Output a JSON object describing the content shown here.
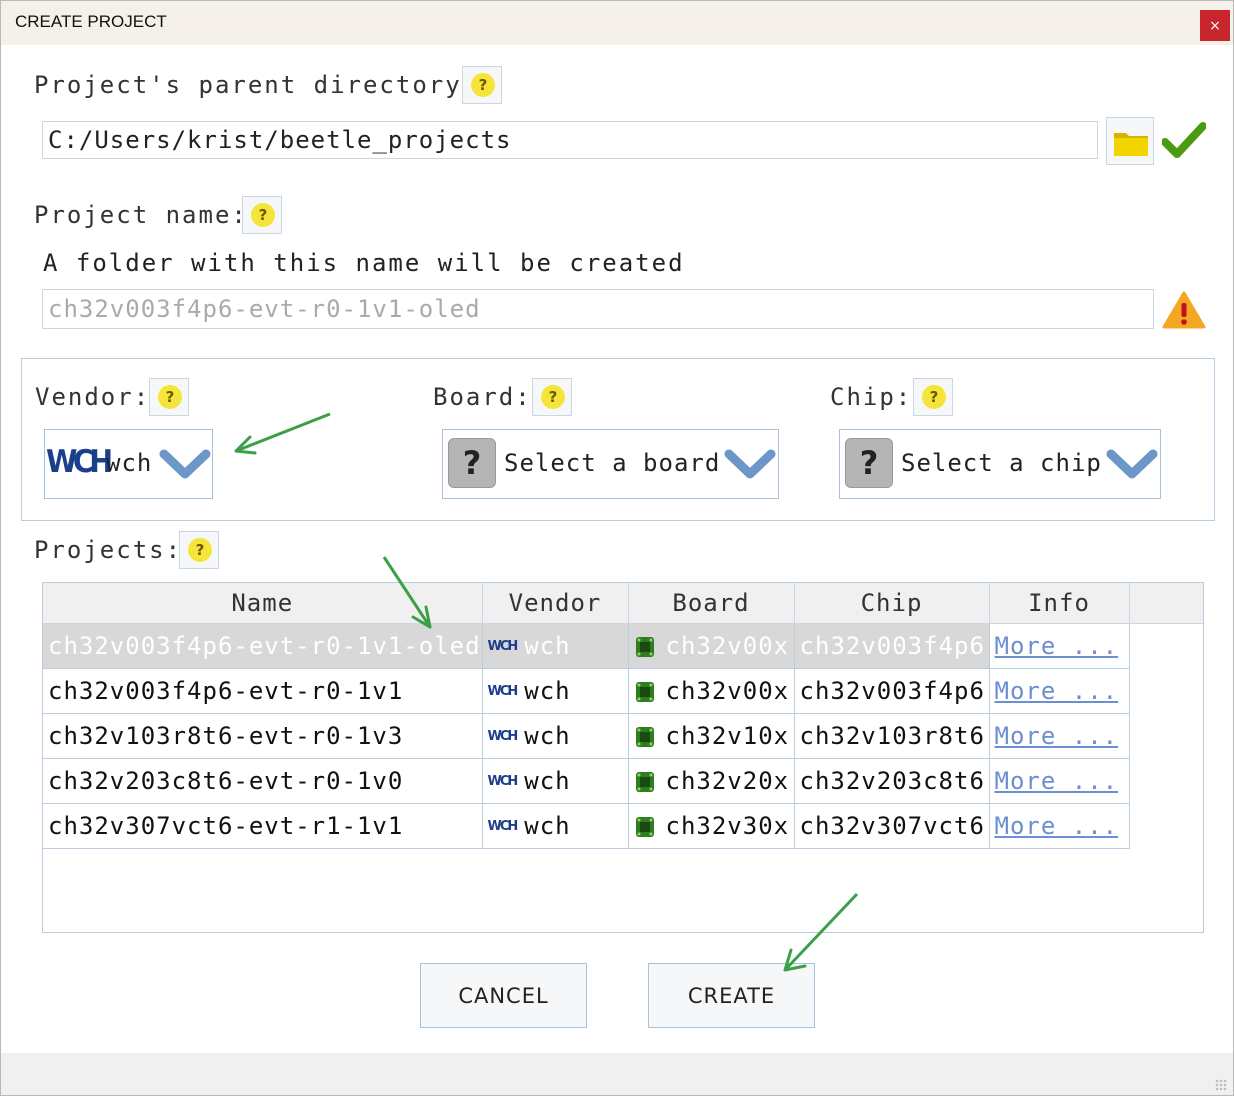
{
  "window": {
    "title": "CREATE PROJECT",
    "close_label": "×"
  },
  "parent_dir": {
    "label": "Project's parent directory:",
    "value": "C:/Users/krist/beetle_projects"
  },
  "project_name": {
    "label": "Project name:",
    "hint": "A folder with this name will be created",
    "placeholder": "ch32v003f4p6-evt-r0-1v1-oled"
  },
  "selectors": {
    "vendor": {
      "label": "Vendor:",
      "logo": "WCH",
      "value": "wch"
    },
    "board": {
      "label": "Board:",
      "value": "Select a board"
    },
    "chip": {
      "label": "Chip:",
      "value": "Select a chip"
    }
  },
  "projects": {
    "label": "Projects:",
    "columns": [
      "Name",
      "Vendor",
      "Board",
      "Chip",
      "Info"
    ],
    "rows": [
      {
        "name": "ch32v003f4p6-evt-r0-1v1-oled",
        "vendor": "wch",
        "board": "ch32v00x",
        "chip": "ch32v003f4p6",
        "info": "More ..."
      },
      {
        "name": "ch32v003f4p6-evt-r0-1v1",
        "vendor": "wch",
        "board": "ch32v00x",
        "chip": "ch32v003f4p6",
        "info": "More ..."
      },
      {
        "name": "ch32v103r8t6-evt-r0-1v3",
        "vendor": "wch",
        "board": "ch32v10x",
        "chip": "ch32v103r8t6",
        "info": "More ..."
      },
      {
        "name": "ch32v203c8t6-evt-r0-1v0",
        "vendor": "wch",
        "board": "ch32v20x",
        "chip": "ch32v203c8t6",
        "info": "More ..."
      },
      {
        "name": "ch32v307vct6-evt-r1-1v1",
        "vendor": "wch",
        "board": "ch32v30x",
        "chip": "ch32v307vct6",
        "info": "More ..."
      }
    ]
  },
  "buttons": {
    "cancel": "CANCEL",
    "create": "CREATE"
  },
  "help_glyph": "?",
  "colors": {
    "accent_arrow": "#3aa048",
    "help_yellow": "#f5e53b",
    "warning": "#f5a623",
    "close_red": "#c9252c"
  }
}
